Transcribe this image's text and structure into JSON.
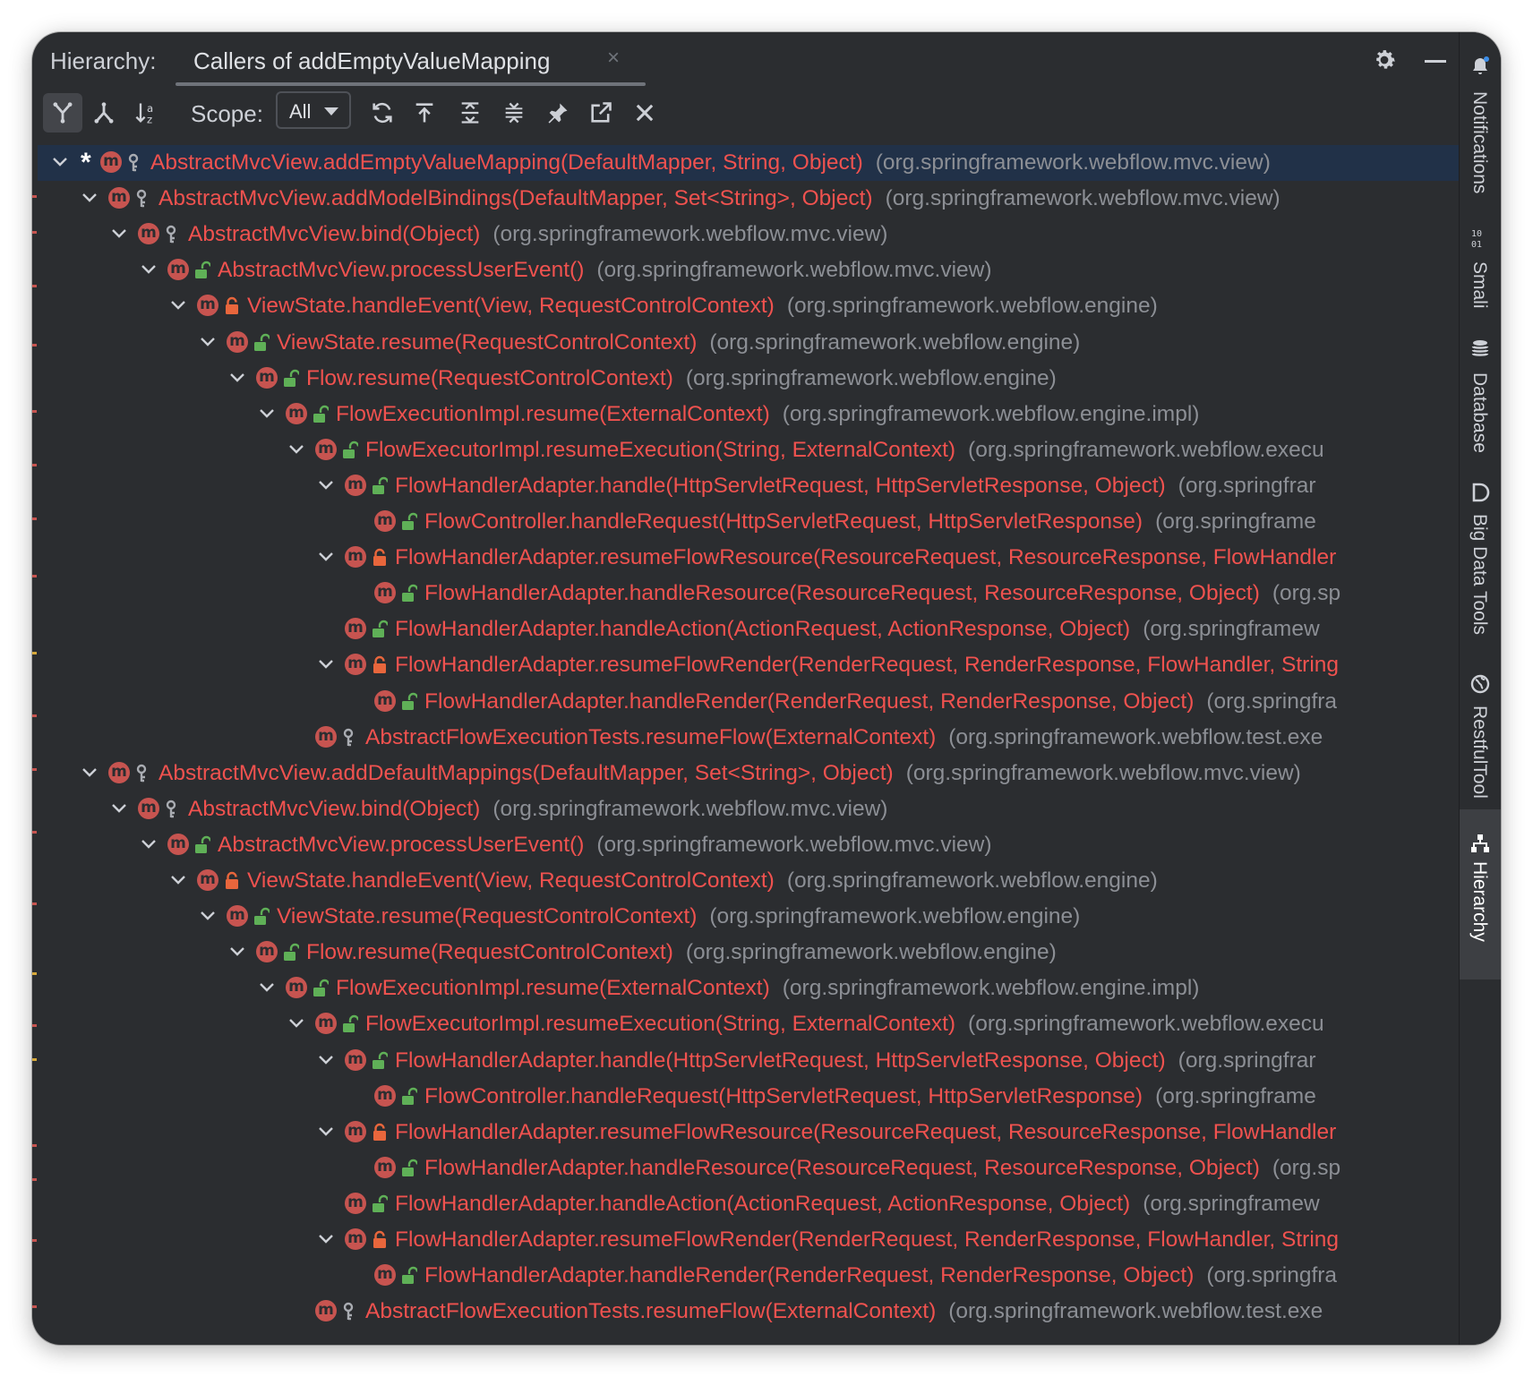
{
  "panel": {
    "label": "Hierarchy:",
    "tab_title": "Callers of addEmptyValueMapping",
    "tab_close": "×"
  },
  "toolbar": {
    "scope_label": "Scope:",
    "scope_value": "All"
  },
  "rows": [
    {
      "indent": 0,
      "chevron": true,
      "star": true,
      "vis": "protected",
      "selected": true,
      "method": "AbstractMvcView.addEmptyValueMapping(DefaultMapper, String, Object)",
      "pkg": "(org.springframework.webflow.mvc.view)"
    },
    {
      "indent": 1,
      "chevron": true,
      "vis": "protected",
      "method": "AbstractMvcView.addModelBindings(DefaultMapper, Set<String>, Object)",
      "pkg": "(org.springframework.webflow.mvc.view)"
    },
    {
      "indent": 2,
      "chevron": true,
      "vis": "protected",
      "method": "AbstractMvcView.bind(Object)",
      "pkg": "(org.springframework.webflow.mvc.view)"
    },
    {
      "indent": 3,
      "chevron": true,
      "vis": "public",
      "method": "AbstractMvcView.processUserEvent()",
      "pkg": "(org.springframework.webflow.mvc.view)"
    },
    {
      "indent": 4,
      "chevron": true,
      "vis": "private",
      "method": "ViewState.handleEvent(View, RequestControlContext)",
      "pkg": "(org.springframework.webflow.engine)"
    },
    {
      "indent": 5,
      "chevron": true,
      "vis": "public",
      "method": "ViewState.resume(RequestControlContext)",
      "pkg": "(org.springframework.webflow.engine)"
    },
    {
      "indent": 6,
      "chevron": true,
      "vis": "public",
      "method": "Flow.resume(RequestControlContext)",
      "pkg": "(org.springframework.webflow.engine)"
    },
    {
      "indent": 7,
      "chevron": true,
      "vis": "public",
      "method": "FlowExecutionImpl.resume(ExternalContext)",
      "pkg": "(org.springframework.webflow.engine.impl)"
    },
    {
      "indent": 8,
      "chevron": true,
      "vis": "public",
      "method": "FlowExecutorImpl.resumeExecution(String, ExternalContext)",
      "pkg": "(org.springframework.webflow.execu"
    },
    {
      "indent": 9,
      "chevron": true,
      "vis": "public",
      "method": "FlowHandlerAdapter.handle(HttpServletRequest, HttpServletResponse, Object)",
      "pkg": "(org.springfrar"
    },
    {
      "indent": 10,
      "chevron": false,
      "vis": "public",
      "method": "FlowController.handleRequest(HttpServletRequest, HttpServletResponse)",
      "pkg": "(org.springframe"
    },
    {
      "indent": 9,
      "chevron": true,
      "vis": "private",
      "method": "FlowHandlerAdapter.resumeFlowResource(ResourceRequest, ResourceResponse, FlowHandler",
      "pkg": ""
    },
    {
      "indent": 10,
      "chevron": false,
      "vis": "public",
      "method": "FlowHandlerAdapter.handleResource(ResourceRequest, ResourceResponse, Object)",
      "pkg": "(org.sp"
    },
    {
      "indent": 9,
      "chevron": false,
      "vis": "public",
      "method": "FlowHandlerAdapter.handleAction(ActionRequest, ActionResponse, Object)",
      "pkg": "(org.springframew"
    },
    {
      "indent": 9,
      "chevron": true,
      "vis": "private",
      "method": "FlowHandlerAdapter.resumeFlowRender(RenderRequest, RenderResponse, FlowHandler, String",
      "pkg": ""
    },
    {
      "indent": 10,
      "chevron": false,
      "vis": "public",
      "method": "FlowHandlerAdapter.handleRender(RenderRequest, RenderResponse, Object)",
      "pkg": "(org.springfra"
    },
    {
      "indent": 8,
      "chevron": false,
      "vis": "protected",
      "method": "AbstractFlowExecutionTests.resumeFlow(ExternalContext)",
      "pkg": "(org.springframework.webflow.test.exe"
    },
    {
      "indent": 1,
      "chevron": true,
      "vis": "protected",
      "method": "AbstractMvcView.addDefaultMappings(DefaultMapper, Set<String>, Object)",
      "pkg": "(org.springframework.webflow.mvc.view)"
    },
    {
      "indent": 2,
      "chevron": true,
      "vis": "protected",
      "method": "AbstractMvcView.bind(Object)",
      "pkg": "(org.springframework.webflow.mvc.view)"
    },
    {
      "indent": 3,
      "chevron": true,
      "vis": "public",
      "method": "AbstractMvcView.processUserEvent()",
      "pkg": "(org.springframework.webflow.mvc.view)"
    },
    {
      "indent": 4,
      "chevron": true,
      "vis": "private",
      "method": "ViewState.handleEvent(View, RequestControlContext)",
      "pkg": "(org.springframework.webflow.engine)"
    },
    {
      "indent": 5,
      "chevron": true,
      "vis": "public",
      "method": "ViewState.resume(RequestControlContext)",
      "pkg": "(org.springframework.webflow.engine)"
    },
    {
      "indent": 6,
      "chevron": true,
      "vis": "public",
      "method": "Flow.resume(RequestControlContext)",
      "pkg": "(org.springframework.webflow.engine)"
    },
    {
      "indent": 7,
      "chevron": true,
      "vis": "public",
      "method": "FlowExecutionImpl.resume(ExternalContext)",
      "pkg": "(org.springframework.webflow.engine.impl)"
    },
    {
      "indent": 8,
      "chevron": true,
      "vis": "public",
      "method": "FlowExecutorImpl.resumeExecution(String, ExternalContext)",
      "pkg": "(org.springframework.webflow.execu"
    },
    {
      "indent": 9,
      "chevron": true,
      "vis": "public",
      "method": "FlowHandlerAdapter.handle(HttpServletRequest, HttpServletResponse, Object)",
      "pkg": "(org.springfrar"
    },
    {
      "indent": 10,
      "chevron": false,
      "vis": "public",
      "method": "FlowController.handleRequest(HttpServletRequest, HttpServletResponse)",
      "pkg": "(org.springframe"
    },
    {
      "indent": 9,
      "chevron": true,
      "vis": "private",
      "method": "FlowHandlerAdapter.resumeFlowResource(ResourceRequest, ResourceResponse, FlowHandler",
      "pkg": ""
    },
    {
      "indent": 10,
      "chevron": false,
      "vis": "public",
      "method": "FlowHandlerAdapter.handleResource(ResourceRequest, ResourceResponse, Object)",
      "pkg": "(org.sp"
    },
    {
      "indent": 9,
      "chevron": false,
      "vis": "public",
      "method": "FlowHandlerAdapter.handleAction(ActionRequest, ActionResponse, Object)",
      "pkg": "(org.springframew"
    },
    {
      "indent": 9,
      "chevron": true,
      "vis": "private",
      "method": "FlowHandlerAdapter.resumeFlowRender(RenderRequest, RenderResponse, FlowHandler, String",
      "pkg": ""
    },
    {
      "indent": 10,
      "chevron": false,
      "vis": "public",
      "method": "FlowHandlerAdapter.handleRender(RenderRequest, RenderResponse, Object)",
      "pkg": "(org.springfra"
    },
    {
      "indent": 8,
      "chevron": false,
      "vis": "protected",
      "method": "AbstractFlowExecutionTests.resumeFlow(ExternalContext)",
      "pkg": "(org.springframework.webflow.test.exe"
    }
  ],
  "sidebar": [
    {
      "label": "Notifications",
      "icon": "bell-icon",
      "active": false
    },
    {
      "label": "Smali",
      "icon": "binary-icon",
      "active": false
    },
    {
      "label": "Database",
      "icon": "database-icon",
      "active": false
    },
    {
      "label": "Big Data Tools",
      "icon": "bigdata-icon",
      "active": false
    },
    {
      "label": "RestfulTool",
      "icon": "globe-icon",
      "active": false
    },
    {
      "label": "Hierarchy",
      "icon": "hierarchy-icon",
      "active": true
    }
  ],
  "colors": {
    "background": "#2b2d30",
    "method": "#f0524f",
    "package": "#8c8f95",
    "selection": "#213148",
    "method_badge": "#c75450",
    "public_lock": "#5fb057",
    "private_lock": "#e8663c",
    "protected_key": "#a9acb2"
  }
}
